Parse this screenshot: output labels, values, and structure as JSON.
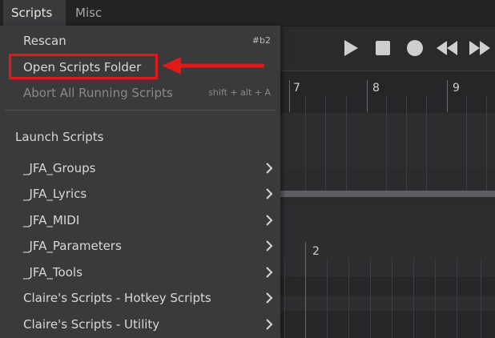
{
  "menubar": {
    "scripts_label": "Scripts",
    "misc_label": "Misc"
  },
  "timeline": {
    "bars": [
      "7",
      "8",
      "9"
    ],
    "lower_bar": "2"
  },
  "menu": {
    "rescan": {
      "label": "Rescan",
      "shortcut": "#b2"
    },
    "open_folder": {
      "label": "Open Scripts Folder"
    },
    "abort": {
      "label": "Abort All Running Scripts",
      "shortcut": "shift + alt + A"
    },
    "section_title": "Launch Scripts",
    "submenus": [
      "_JFA_Groups",
      "_JFA_Lyrics",
      "_JFA_MIDI",
      "_JFA_Parameters",
      "_JFA_Tools",
      "Claire's Scripts - Hotkey Scripts",
      "Claire's Scripts - Utility"
    ]
  },
  "colors": {
    "highlight": "#e01919",
    "menu_bg": "#3a3a3d"
  }
}
